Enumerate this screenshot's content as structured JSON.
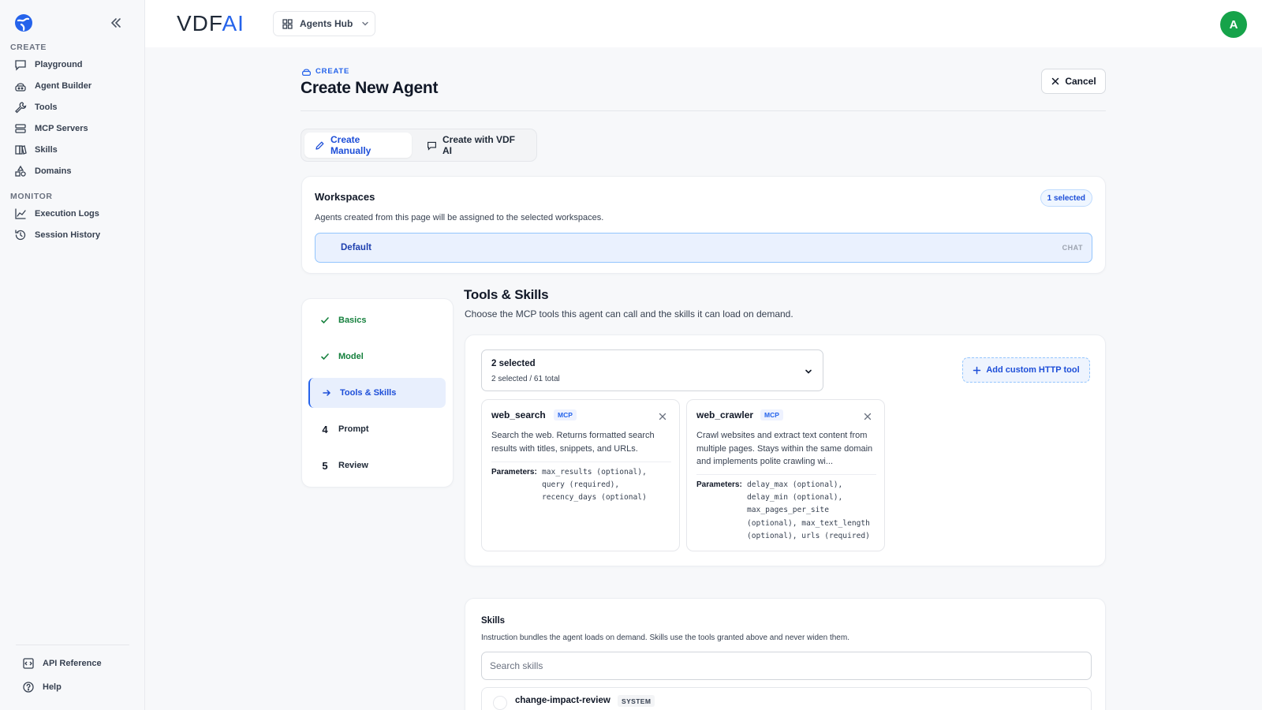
{
  "sidebar": {
    "sections": [
      {
        "label": "CREATE",
        "items": [
          {
            "label": "Playground",
            "icon": "chat-icon"
          },
          {
            "label": "Agent Builder",
            "icon": "robot-icon"
          },
          {
            "label": "Tools",
            "icon": "wrench-icon"
          },
          {
            "label": "MCP Servers",
            "icon": "server-icon"
          },
          {
            "label": "Skills",
            "icon": "book-icon"
          },
          {
            "label": "Domains",
            "icon": "shapes-icon"
          }
        ]
      },
      {
        "label": "MONITOR",
        "items": [
          {
            "label": "Execution Logs",
            "icon": "line-chart-icon"
          },
          {
            "label": "Session History",
            "icon": "history-icon"
          }
        ]
      }
    ],
    "footer": [
      {
        "label": "API Reference",
        "icon": "code-icon"
      },
      {
        "label": "Help",
        "icon": "help-icon"
      }
    ]
  },
  "header": {
    "brand": "VDF",
    "brand_accent": "AI",
    "hub_label": "Agents Hub",
    "avatar_initial": "A",
    "avatar_color": "#16a34a"
  },
  "page": {
    "eyebrow": "CREATE",
    "title": "Create New Agent",
    "cancel_label": "Cancel"
  },
  "modes": {
    "manual": "Create Manually",
    "ai": "Create with VDF AI"
  },
  "workspaces": {
    "title": "Workspaces",
    "badge": "1 selected",
    "description": "Agents created from this page will be assigned to the selected workspaces.",
    "option_name": "Default",
    "option_tag": "CHAT"
  },
  "steps": [
    {
      "label": "Basics",
      "state": "done",
      "marker": "✓"
    },
    {
      "label": "Model",
      "state": "done",
      "marker": "✓"
    },
    {
      "label": "Tools & Skills",
      "state": "current",
      "marker": "→"
    },
    {
      "label": "Prompt",
      "state": "todo",
      "marker": "4"
    },
    {
      "label": "Review",
      "state": "todo",
      "marker": "5"
    }
  ],
  "tools_section": {
    "title": "Tools & Skills",
    "description": "Choose the MCP tools this agent can call and the skills it can load on demand.",
    "select_value": "2 selected",
    "select_sub": "2 selected / 61 total",
    "add_label": "Add custom HTTP tool",
    "params_label": "Parameters:",
    "tools": [
      {
        "name": "web_search",
        "tag": "MCP",
        "description": "Search the web. Returns formatted search results with titles, snippets, and URLs.",
        "params": "max_results (optional),\nquery (required),\nrecency_days (optional)"
      },
      {
        "name": "web_crawler",
        "tag": "MCP",
        "description": "Crawl websites and extract text content from multiple pages. Stays within the same domain and implements polite crawling wi...",
        "params": "delay_max (optional),\ndelay_min (optional),\nmax_pages_per_site\n(optional), max_text_length\n(optional), urls (required)"
      }
    ]
  },
  "skills": {
    "title": "Skills",
    "description": "Instruction bundles the agent loads on demand. Skills use the tools granted above and never widen them.",
    "search_placeholder": "Search skills",
    "items": [
      {
        "name": "change-impact-review",
        "tag": "SYSTEM"
      }
    ]
  }
}
